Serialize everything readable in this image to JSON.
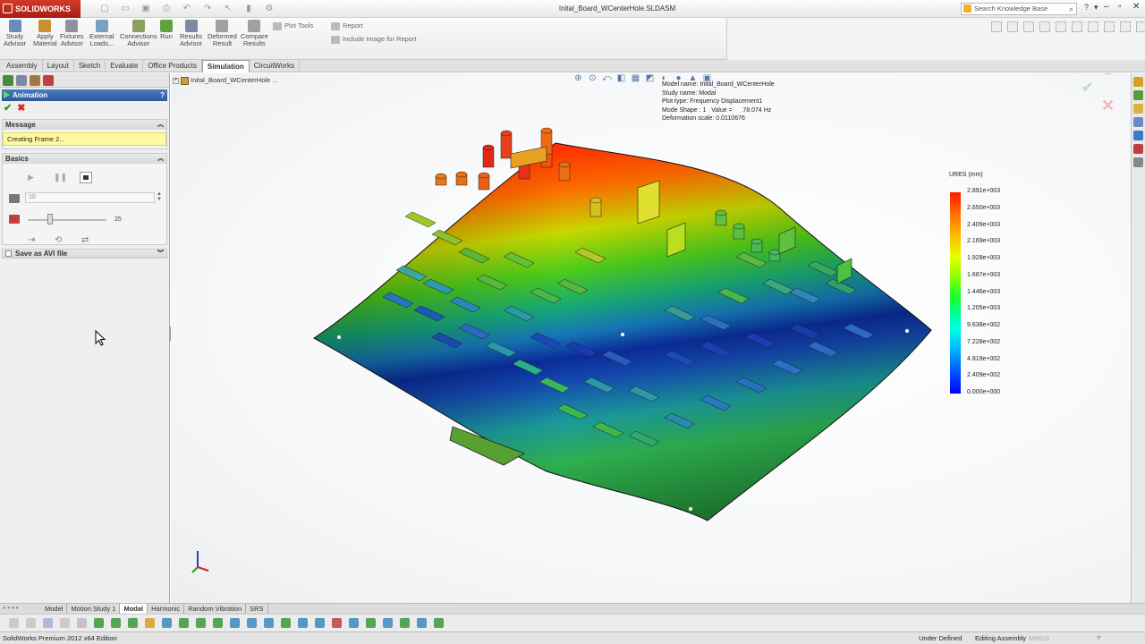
{
  "app": {
    "logo_text": "SOLIDWORKS",
    "document_title": "Inital_Board_WCenterHole.SLDASM"
  },
  "search": {
    "placeholder": "Search Knowledge Base"
  },
  "ribbon": {
    "commands": [
      {
        "label": "Study\nAdvisor",
        "icon": "study-advisor-icon"
      },
      {
        "label": "Apply\nMaterial",
        "icon": "apply-material-icon"
      },
      {
        "label": "Fixtures\nAdvisor",
        "icon": "fixtures-advisor-icon"
      },
      {
        "label": "External\nLoads...",
        "icon": "external-loads-icon"
      },
      {
        "label": "Connections\nAdvisor",
        "icon": "connections-advisor-icon"
      },
      {
        "label": "Run",
        "icon": "run-icon"
      },
      {
        "label": "Results\nAdvisor",
        "icon": "results-advisor-icon"
      },
      {
        "label": "Deformed\nResult",
        "icon": "deformed-result-icon"
      },
      {
        "label": "Compare\nResults",
        "icon": "compare-results-icon"
      }
    ],
    "plot_tools": "Plot Tools",
    "report": "Report",
    "include_image": "Include Image for Report"
  },
  "tabs": [
    "Assembly",
    "Layout",
    "Sketch",
    "Evaluate",
    "Office Products",
    "Simulation",
    "CircuitWorks"
  ],
  "active_tab": "Simulation",
  "property_manager": {
    "title": "Animation",
    "help": "?",
    "message_group": "Message",
    "message_text": "Creating Frame 2...",
    "basics_group": "Basics",
    "frames_value": "10",
    "speed_value": "25",
    "save_avi_label": "Save as AVI file"
  },
  "tree": {
    "root_label": "Inital_Board_WCenterHole ..."
  },
  "plot_info": {
    "model_name": "Model name: Inital_Board_WCenterHole",
    "study_name": "Study name: Modal",
    "plot_type": "Plot type: Frequency Displacement1",
    "mode_shape": "Mode Shape : 1   Value =      78.074 Hz",
    "deformation": "Deformation scale: 0.0110676"
  },
  "legend": {
    "title": "URES (mm)",
    "labels": [
      "2.891e+003",
      "2.650e+003",
      "2.409e+003",
      "2.169e+003",
      "1.928e+003",
      "1.687e+003",
      "1.446e+003",
      "1.205e+003",
      "9.638e+002",
      "7.228e+002",
      "4.819e+002",
      "2.409e+002",
      "0.000e+000"
    ]
  },
  "bottom_tabs": [
    "Model",
    "Motion Study 1",
    "Modal",
    "Harmonic",
    "Random Vibration",
    "SRS"
  ],
  "active_bottom_tab": "Modal",
  "status": {
    "edition": "SolidWorks Premium 2012 x64 Edition",
    "under_defined": "Under Defined",
    "editing": "Editing Assembly",
    "units": "MMGS",
    "help": "?"
  }
}
